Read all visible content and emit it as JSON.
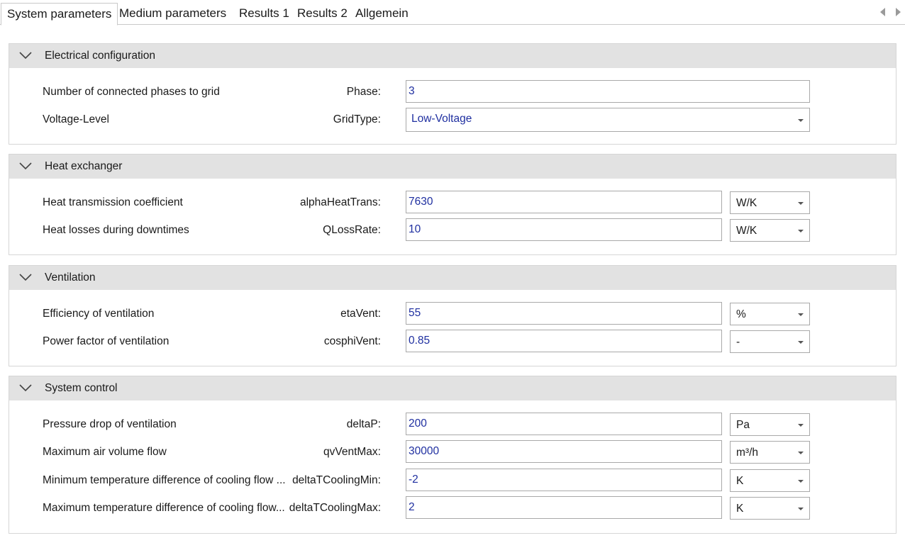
{
  "tabs": [
    "System parameters",
    "Medium parameters",
    "Results 1",
    "Results 2",
    "Allgemein"
  ],
  "groups": [
    {
      "title": "Electrical configuration",
      "rows": [
        {
          "desc": "Number of connected phases to grid",
          "var": "Phase:",
          "value": "3"
        },
        {
          "desc": "Voltage-Level",
          "var": "GridType:",
          "value": "Low-Voltage"
        }
      ]
    },
    {
      "title": "Heat exchanger",
      "rows": [
        {
          "desc": "Heat transmission coefficient",
          "var": "alphaHeatTrans:",
          "value": "7630",
          "unit": "W/K"
        },
        {
          "desc": "Heat losses during downtimes",
          "var": "QLossRate:",
          "value": "10",
          "unit": "W/K"
        }
      ]
    },
    {
      "title": "Ventilation",
      "rows": [
        {
          "desc": "Efficiency of ventilation",
          "var": "etaVent:",
          "value": "55",
          "unit": "%"
        },
        {
          "desc": "Power factor of ventilation",
          "var": "cosphiVent:",
          "value": "0.85",
          "unit": "-"
        }
      ]
    },
    {
      "title": "System control",
      "rows": [
        {
          "desc": "Pressure drop of ventilation",
          "var": "deltaP:",
          "value": "200",
          "unit": "Pa"
        },
        {
          "desc": "Maximum air volume flow",
          "var": "qvVentMax:",
          "value": "30000",
          "unit": "m³/h"
        },
        {
          "desc": "Minimum temperature difference of cooling flow ...",
          "var": "deltaTCoolingMin:",
          "value": "-2",
          "unit": "K"
        },
        {
          "desc": "Maximum temperature difference of cooling flow...",
          "var": "deltaTCoolingMax:",
          "value": "2",
          "unit": "K"
        }
      ]
    }
  ]
}
